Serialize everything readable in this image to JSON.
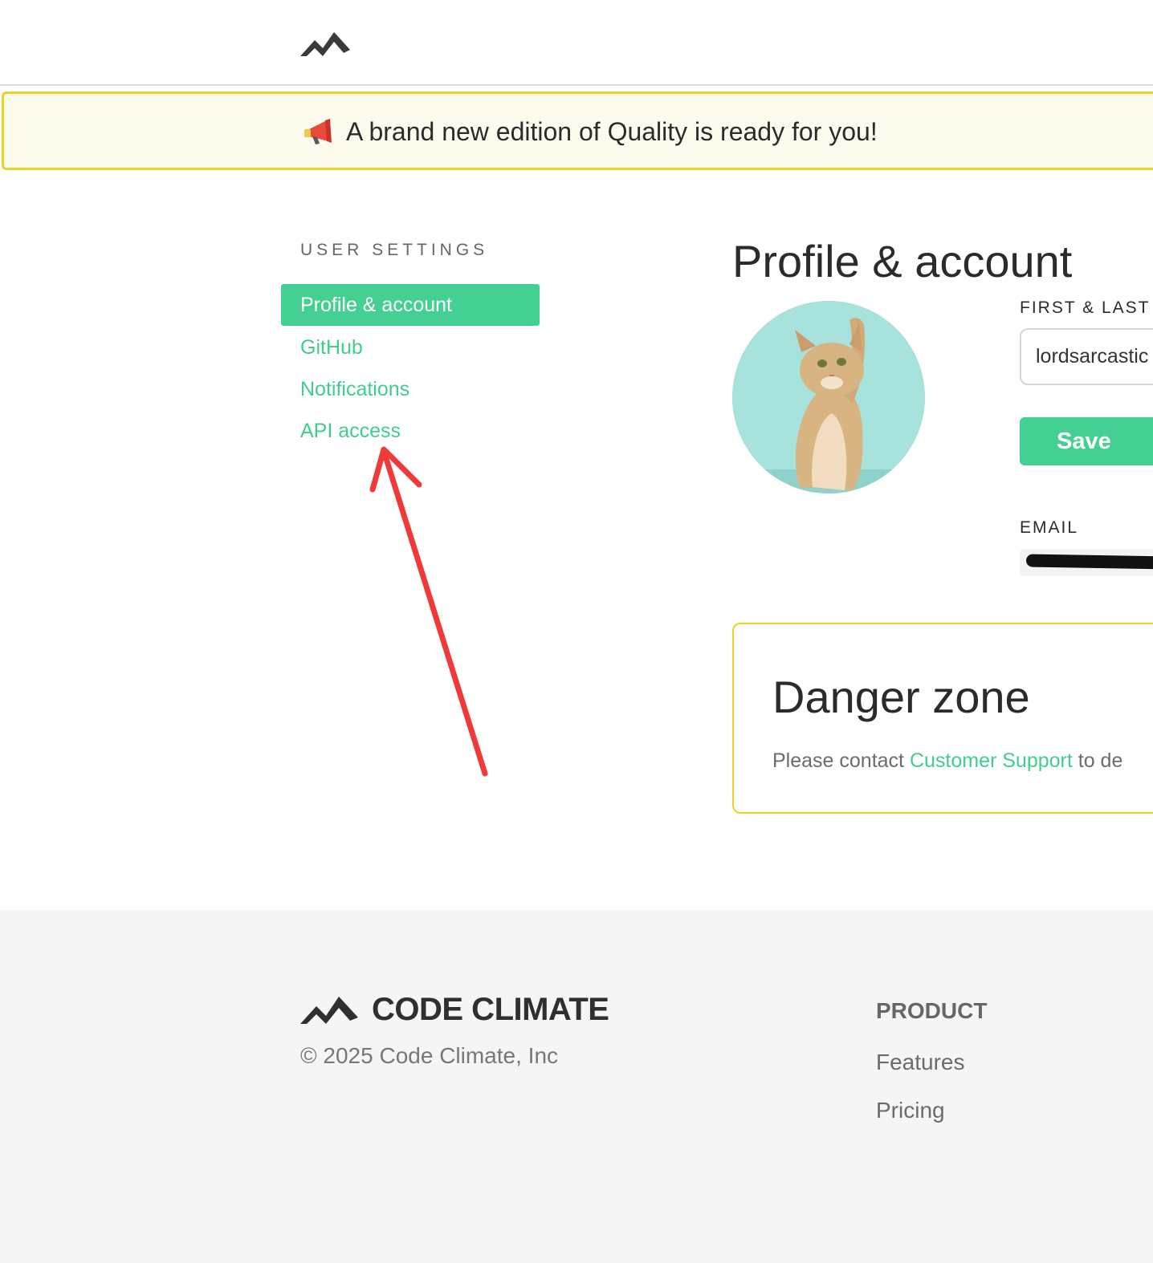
{
  "header": {
    "logo_icon": "code-climate-mountains-icon"
  },
  "banner": {
    "icon": "megaphone-icon",
    "text": "A brand new edition of Quality is ready for you!"
  },
  "sidebar": {
    "heading": "USER SETTINGS",
    "items": [
      {
        "label": "Profile & account",
        "active": true
      },
      {
        "label": "GitHub",
        "active": false
      },
      {
        "label": "Notifications",
        "active": false
      },
      {
        "label": "API access",
        "active": false
      }
    ]
  },
  "main": {
    "title": "Profile & account",
    "avatar_icon": "kitten-avatar-icon",
    "name_field": {
      "label": "FIRST & LAST",
      "value": "lordsarcastic"
    },
    "save_label": "Save",
    "email_field": {
      "label": "EMAIL",
      "value_redacted": true
    },
    "danger_zone": {
      "title": "Danger zone",
      "text_before": "Please contact ",
      "link": "Customer Support",
      "text_after": " to de"
    }
  },
  "footer": {
    "wordmark": "CODE CLIMATE",
    "copyright": "© 2025 Code Climate, Inc",
    "product_heading": "PRODUCT",
    "product_links": [
      "Features",
      "Pricing"
    ]
  },
  "annotation": {
    "type": "red-arrow",
    "color": "#f03a3a",
    "points_to": "API access"
  },
  "colors": {
    "accent_green": "#45d093",
    "banner_border": "#efd024",
    "banner_bg": "#fdfbee",
    "footer_bg": "#f5f5f5"
  }
}
